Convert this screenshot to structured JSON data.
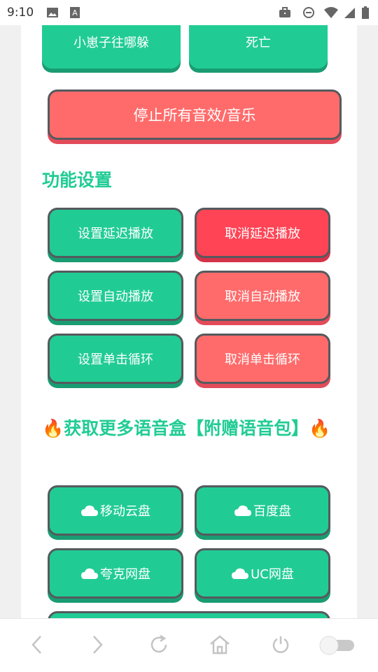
{
  "status_bar": {
    "time": "9:10",
    "icons": [
      "image-icon",
      "a-icon",
      "briefcase-icon",
      "do-not-disturb-icon",
      "wifi-icon",
      "signal-icon",
      "battery-icon"
    ]
  },
  "top_buttons": [
    "小崽子往哪躲",
    "死亡"
  ],
  "stop_all_button": "停止所有音效/音乐",
  "section_settings": {
    "title": "功能设置",
    "buttons": [
      "设置延迟播放",
      "取消延迟播放",
      "设置自动播放",
      "取消自动播放",
      "设置单击循环",
      "取消单击循环"
    ]
  },
  "section_more": {
    "title": "🔥获取更多语音盒【附赠语音包】🔥",
    "buttons": [
      "移动云盘",
      "百度盘",
      "夸克网盘",
      "UC网盘"
    ]
  },
  "bottom_bar": {
    "icons": [
      "back-icon",
      "forward-icon",
      "refresh-icon",
      "home-icon",
      "power-icon",
      "toggle-switch"
    ]
  },
  "colors": {
    "green": "#21cc94",
    "red": "#ff6b6b",
    "deep_red": "#ff4455",
    "border": "#555a5e"
  }
}
